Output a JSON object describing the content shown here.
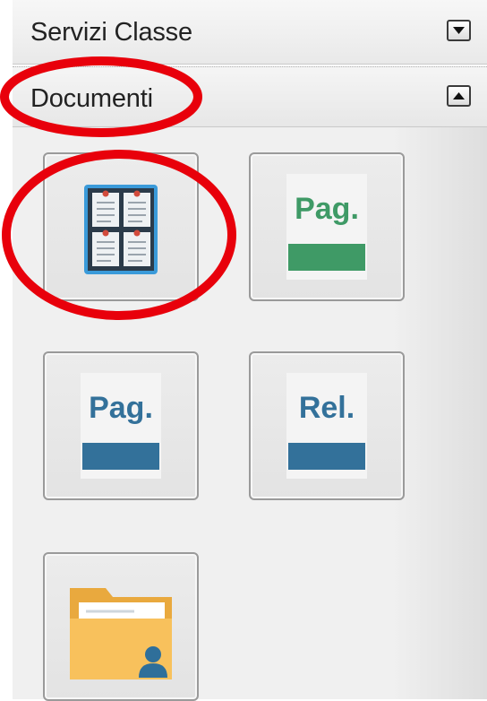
{
  "sections": [
    {
      "title": "Servizi Classe",
      "state": "collapsed"
    },
    {
      "title": "Documenti",
      "state": "expanded"
    }
  ],
  "documenti_tiles": [
    {
      "icon": "bulletin-board-icon",
      "text": ""
    },
    {
      "icon": "page-green-icon",
      "text": "Pag."
    },
    {
      "icon": "page-blue-icon",
      "text": "Pag."
    },
    {
      "icon": "report-blue-icon",
      "text": "Rel."
    },
    {
      "icon": "user-folder-icon",
      "text": ""
    }
  ],
  "colors": {
    "annotation": "#e8000b",
    "green": "#3f9a66",
    "blue": "#33719a",
    "folder": "#f8c15c",
    "board": "#3a9ad9"
  }
}
